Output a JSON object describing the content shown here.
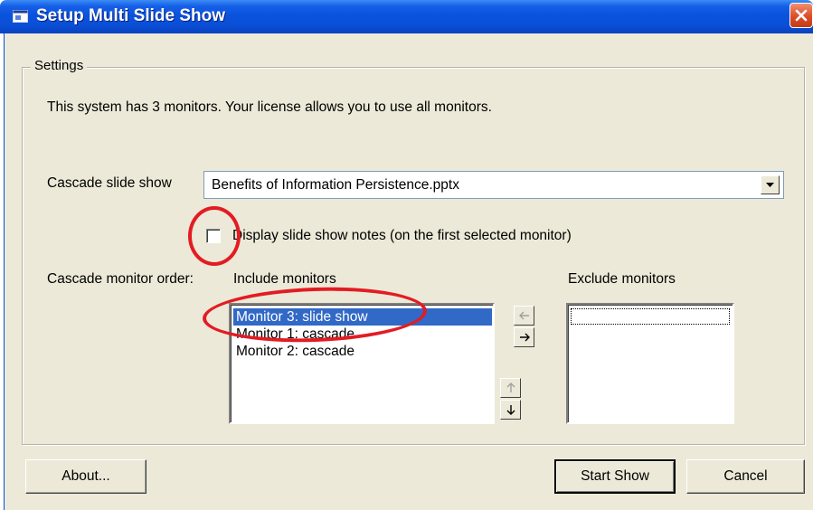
{
  "window": {
    "title": "Setup Multi Slide Show"
  },
  "settings": {
    "legend": "Settings",
    "info_text": "This system has 3 monitors. Your license allows you to use all monitors.",
    "cascade_label": "Cascade slide show",
    "cascade_value": "Benefits of Information Persistence.pptx",
    "notes_checkbox_label": "Display slide show notes (on the first selected monitor)",
    "notes_checked": false,
    "monitor_order_label": "Cascade monitor order:",
    "include_label": "Include monitors",
    "exclude_label": "Exclude monitors",
    "include_items": [
      "Monitor 3: slide show",
      "Monitor 1: cascade",
      "Monitor 2: cascade"
    ],
    "selected_include_index": 0,
    "exclude_items": []
  },
  "icons": {
    "move_left": "arrow-left-icon",
    "move_right": "arrow-right-icon",
    "move_up": "arrow-up-icon",
    "move_down": "arrow-down-icon"
  },
  "buttons": {
    "about": "About...",
    "start": "Start Show",
    "cancel": "Cancel"
  },
  "colors": {
    "selection": "#3169c6",
    "annotation": "#e31b23",
    "titlebar": "#0a53dd",
    "close": "#dd4d28"
  }
}
